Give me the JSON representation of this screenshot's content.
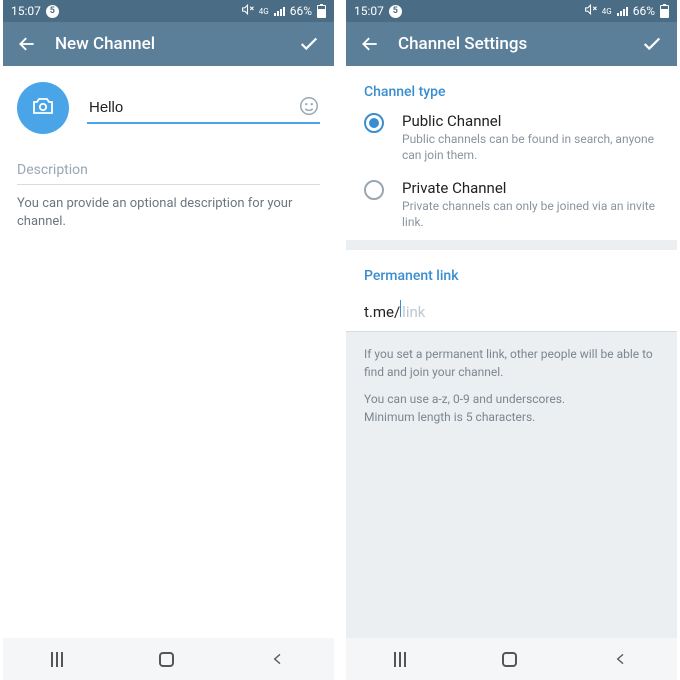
{
  "status": {
    "time": "15:07",
    "notif_count": "5",
    "net_label": "4G",
    "battery": "66%"
  },
  "left": {
    "appbar_title": "New Channel",
    "channel_name": "Hello",
    "desc_label": "Description",
    "desc_hint": "You can provide an optional description for your channel."
  },
  "right": {
    "appbar_title": "Channel Settings",
    "section_type": "Channel type",
    "public": {
      "label": "Public Channel",
      "desc": "Public channels can be found in search, anyone can join them."
    },
    "private": {
      "label": "Private Channel",
      "desc": "Private channels can only be joined via an invite link."
    },
    "section_link": "Permanent link",
    "link_prefix": "t.me/",
    "link_placeholder": "link",
    "info1": "If you set a permanent link, other people will be able to find and join your channel.",
    "info2": "You can use a-z, 0-9 and underscores.\nMinimum length is 5 characters."
  }
}
